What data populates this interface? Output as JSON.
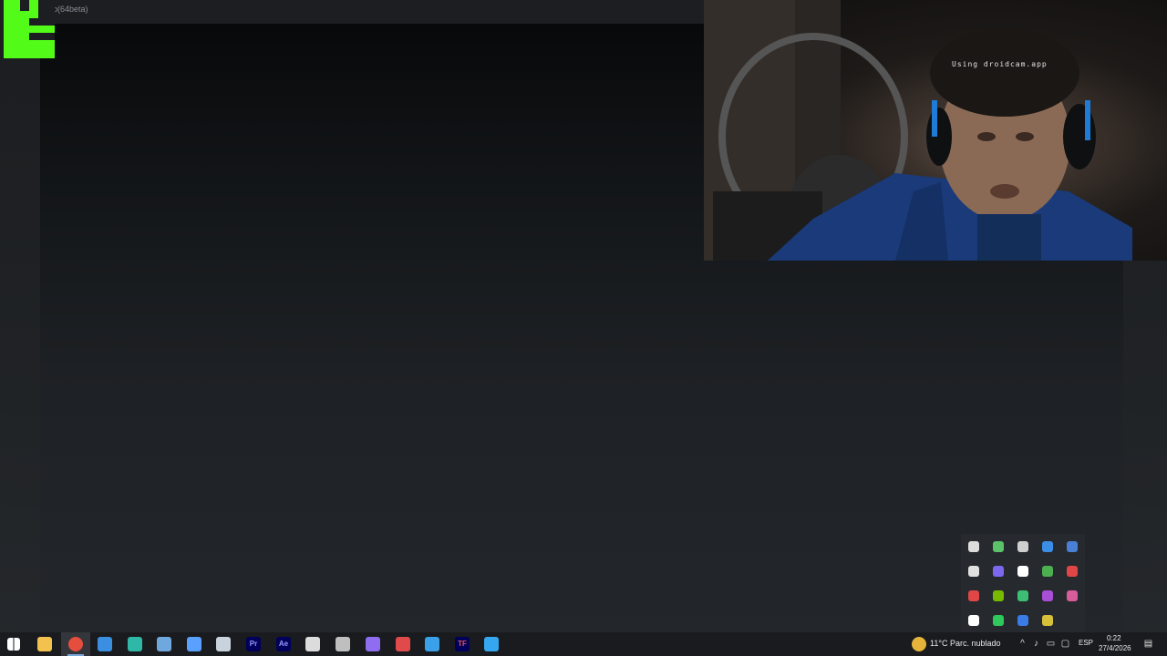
{
  "app": {
    "title_fragment": "p(64beta)"
  },
  "webcam": {
    "watermark": "Using droidcam.app"
  },
  "taskbar": {
    "apps": [
      {
        "name": "start-button-icon",
        "color": "#ffffff"
      },
      {
        "name": "file-explorer-icon",
        "color": "#f2c14e"
      },
      {
        "name": "chrome-icon",
        "color": "#e54d3c"
      },
      {
        "name": "mail-icon",
        "color": "#3b8fe0"
      },
      {
        "name": "edge-icon",
        "color": "#2fb7a7"
      },
      {
        "name": "app-icon-diamond",
        "color": "#6fa8dc"
      },
      {
        "name": "vtube-icon",
        "color": "#5aa0ff"
      },
      {
        "name": "steam-icon",
        "color": "#c9d3de"
      },
      {
        "name": "premiere-pro-icon",
        "color": "#9999ff",
        "label": "Pr"
      },
      {
        "name": "after-effects-icon",
        "color": "#9999ff",
        "label": "Ae"
      },
      {
        "name": "store-icon",
        "color": "#dcdcdc"
      },
      {
        "name": "gamepad-icon",
        "color": "#bfbfbf"
      },
      {
        "name": "obs-icon",
        "color": "#8e6df0"
      },
      {
        "name": "app-icon-red",
        "color": "#e14a4a"
      },
      {
        "name": "paint-icon",
        "color": "#3aa0e8"
      },
      {
        "name": "tf-icon",
        "color": "#e85555",
        "label": "TF"
      },
      {
        "name": "browser-icon",
        "color": "#35a7f0"
      }
    ],
    "weather": "11°C  Parc. nublado",
    "language": "ESP",
    "time": "0:22",
    "date": "27/4/2026"
  },
  "tray_popup": {
    "icons": [
      "usb-icon",
      "shield-icon",
      "keyboard-icon",
      "blue-circle-icon",
      "brush-icon",
      "g-icon",
      "teams-icon",
      "microphone-icon",
      "play-icon",
      "sync-icon",
      "red-app-icon",
      "nvidia-icon",
      "green-circle-icon",
      "onenote-icon",
      "color-app-icon",
      "screen-icon",
      "whatsapp-icon",
      "blue-app-icon",
      "yellow-app-icon"
    ],
    "colors": [
      "#dddddd",
      "#5bc26a",
      "#cfcfcf",
      "#3a8ee6",
      "#4a7fd6",
      "#e0e0e0",
      "#7b68ee",
      "#ffffff",
      "#4caf50",
      "#e04646",
      "#e04646",
      "#76b900",
      "#3cbf74",
      "#a84fd6",
      "#d65c9a",
      "#ffffff",
      "#2ec95a",
      "#3a7be6",
      "#d6c23a"
    ]
  }
}
